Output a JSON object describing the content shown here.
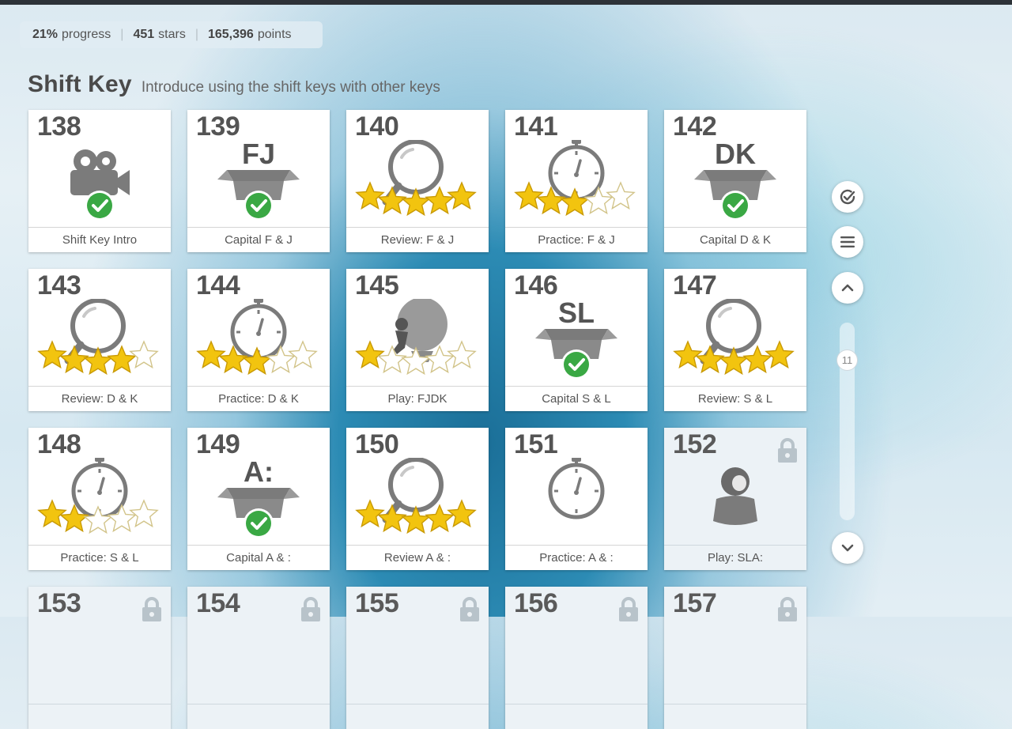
{
  "stats": {
    "progress_value": "21%",
    "progress_label": "progress",
    "stars_value": "451",
    "stars_label": "stars",
    "points_value": "165,396",
    "points_label": "points"
  },
  "section": {
    "title": "Shift Key",
    "subtitle": "Introduce using the shift keys with other keys"
  },
  "lessons": [
    {
      "num": "138",
      "label": "Shift Key Intro",
      "icon": "video-camera-icon",
      "badge": "check",
      "stars": null,
      "locked": false
    },
    {
      "num": "139",
      "label": "Capital F & J",
      "icon": "box-icon",
      "box_text": "FJ",
      "badge": "check",
      "stars": null,
      "locked": false
    },
    {
      "num": "140",
      "label": "Review: F & J",
      "icon": "magnifier-icon",
      "stars": 5,
      "locked": false
    },
    {
      "num": "141",
      "label": "Practice: F & J",
      "icon": "stopwatch-icon",
      "stars": 3,
      "locked": false
    },
    {
      "num": "142",
      "label": "Capital D & K",
      "icon": "box-icon",
      "box_text": "DK",
      "badge": "check",
      "stars": null,
      "locked": false
    },
    {
      "num": "143",
      "label": "Review: D & K",
      "icon": "magnifier-icon",
      "stars": 4,
      "locked": false
    },
    {
      "num": "144",
      "label": "Practice: D & K",
      "icon": "stopwatch-icon",
      "stars": 3,
      "locked": false
    },
    {
      "num": "145",
      "label": "Play: FJDK",
      "icon": "balloon-icon",
      "stars": 1,
      "locked": false
    },
    {
      "num": "146",
      "label": "Capital S & L",
      "icon": "box-icon",
      "box_text": "SL",
      "badge": "check",
      "stars": null,
      "locked": false
    },
    {
      "num": "147",
      "label": "Review: S & L",
      "icon": "magnifier-icon",
      "stars": 5,
      "locked": false
    },
    {
      "num": "148",
      "label": "Practice: S & L",
      "icon": "stopwatch-icon",
      "stars": 2,
      "locked": false
    },
    {
      "num": "149",
      "label": "Capital A & :",
      "icon": "box-icon",
      "box_text": "A:",
      "badge": "check",
      "stars": null,
      "locked": false
    },
    {
      "num": "150",
      "label": "Review A & :",
      "icon": "magnifier-icon",
      "stars": 5,
      "locked": false
    },
    {
      "num": "151",
      "label": "Practice: A & :",
      "icon": "stopwatch-icon",
      "stars": 0,
      "locked": false
    },
    {
      "num": "152",
      "label": "Play: SLA:",
      "icon": "pot-creature-icon",
      "stars": null,
      "locked": true
    },
    {
      "num": "153",
      "label": "",
      "icon": "",
      "stars": null,
      "locked": true
    },
    {
      "num": "154",
      "label": "",
      "icon": "",
      "stars": null,
      "locked": true
    },
    {
      "num": "155",
      "label": "",
      "icon": "",
      "stars": null,
      "locked": true
    },
    {
      "num": "156",
      "label": "",
      "icon": "",
      "stars": null,
      "locked": true
    },
    {
      "num": "157",
      "label": "",
      "icon": "",
      "stars": null,
      "locked": true
    }
  ],
  "side_controls": {
    "progress_button_icon": "check-circle-icon",
    "menu_button_icon": "menu-icon",
    "up_button_icon": "chevron-up-icon",
    "down_button_icon": "chevron-down-icon",
    "scroll_position": "11"
  },
  "colors": {
    "star_gold": "#f2c40f",
    "check_green": "#3aa844",
    "icon_gray": "#7b7b7b"
  }
}
